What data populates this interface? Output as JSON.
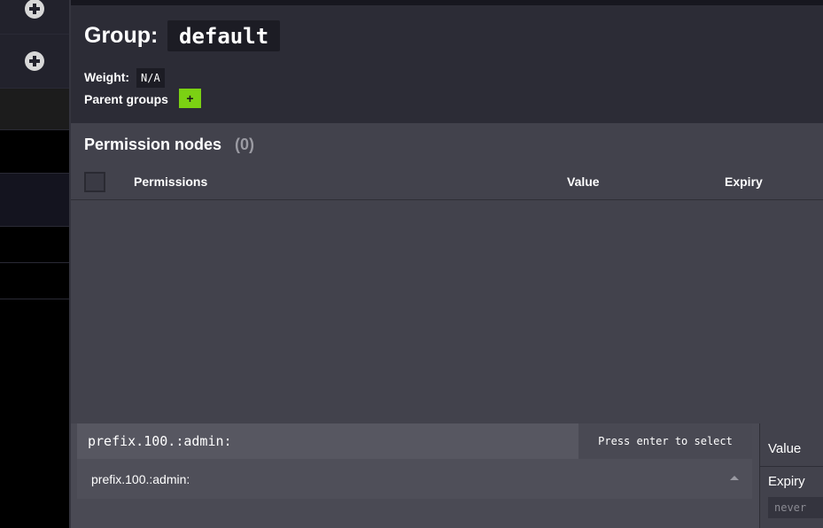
{
  "group": {
    "title_label": "Group:",
    "name": "default",
    "weight_label": "Weight:",
    "weight_value": "N/A",
    "parent_groups_label": "Parent groups",
    "add_parent_label": "+"
  },
  "permissions": {
    "title": "Permission nodes",
    "count": "(0)",
    "columns": [
      "Permissions",
      "Value",
      "Expiry"
    ]
  },
  "add_permission": {
    "input_value": "prefix.100.:admin:",
    "hint": "Press enter to select",
    "suggestion": "prefix.100.:admin:",
    "value_label": "Value",
    "expiry_label": "Expiry",
    "expiry_placeholder": "never"
  },
  "icons": {
    "sidebar_add": "plus-circle-icon",
    "suggestion_caret": "caret-up-icon"
  },
  "colors": {
    "accent_green": "#7bd113",
    "header_bg": "#2c2c36",
    "panel_bg": "#42424c"
  }
}
